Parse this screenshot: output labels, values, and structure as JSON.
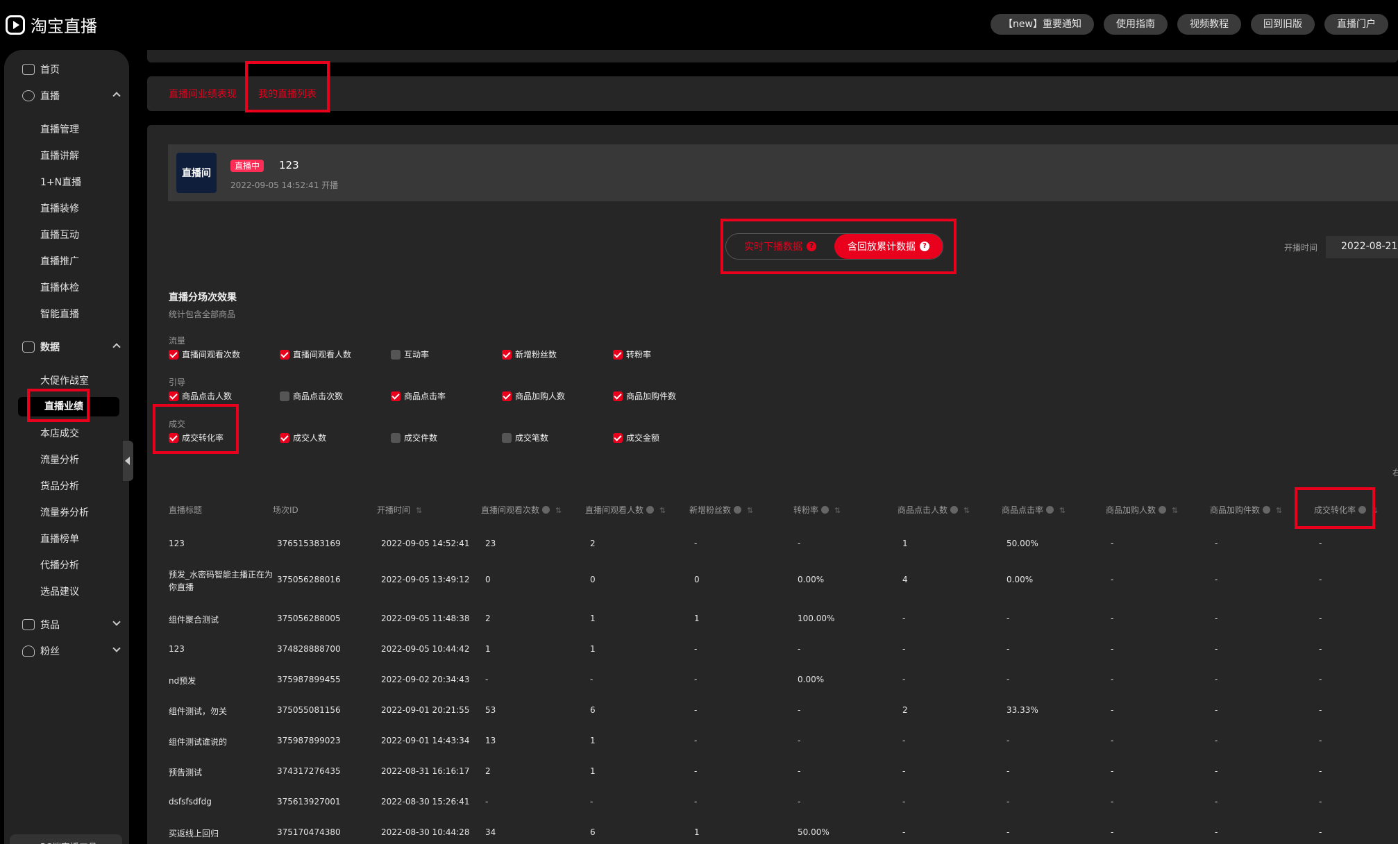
{
  "app": {
    "logo_text": "淘宝直播",
    "top_links": [
      "【new】重要通知",
      "使用指南",
      "视频教程",
      "回到旧版",
      "直播门户"
    ]
  },
  "sidebar": {
    "home": "首页",
    "live_group": "直播",
    "live_items": [
      "直播管理",
      "直播讲解",
      "1+N直播",
      "直播装修",
      "直播互动",
      "直播推广",
      "直播体检",
      "智能直播"
    ],
    "data_group": "数据",
    "data_items": [
      "大促作战室",
      "直播业绩",
      "本店成交",
      "流量分析",
      "货品分析",
      "流量券分析",
      "直播榜单",
      "代播分析",
      "选品建议"
    ],
    "active_item": "直播业绩",
    "goods_group": "货品",
    "fans_group": "粉丝",
    "bottom_tool": "PC端直播工具"
  },
  "tabs": [
    "直播间业绩表现",
    "我的直播列表"
  ],
  "live_card": {
    "thumb_text": "直播间",
    "badge": "直播中",
    "title": "123",
    "time": "2022-09-05 14:52:41 开播"
  },
  "toggle": {
    "realtime": "实时下播数据",
    "cumulative": "含回放累计数据",
    "selected": "含回放累计数据"
  },
  "date_filter": {
    "label": "开播时间",
    "value": "2022-08-21"
  },
  "section": {
    "title": "直播分场次效果",
    "subtitle": "统计包含全部商品"
  },
  "metric_groups": [
    {
      "label": "流量",
      "options": [
        {
          "label": "直播间观看次数",
          "checked": true
        },
        {
          "label": "直播间观看人数",
          "checked": true
        },
        {
          "label": "互动率",
          "checked": false
        },
        {
          "label": "新增粉丝数",
          "checked": true
        },
        {
          "label": "转粉率",
          "checked": true
        }
      ]
    },
    {
      "label": "引导",
      "options": [
        {
          "label": "商品点击人数",
          "checked": true
        },
        {
          "label": "商品点击次数",
          "checked": false
        },
        {
          "label": "商品点击率",
          "checked": true
        },
        {
          "label": "商品加购人数",
          "checked": true
        },
        {
          "label": "商品加购件数",
          "checked": true
        }
      ]
    },
    {
      "label": "成交",
      "options": [
        {
          "label": "成交转化率",
          "checked": true
        },
        {
          "label": "成交人数",
          "checked": true
        },
        {
          "label": "成交件数",
          "checked": false
        },
        {
          "label": "成交笔数",
          "checked": false
        },
        {
          "label": "成交金额",
          "checked": true
        }
      ]
    }
  ],
  "table": {
    "columns": [
      "直播标题",
      "场次ID",
      "开播时间",
      "直播间观看次数",
      "直播间观看人数",
      "新增粉丝数",
      "转粉率",
      "商品点击人数",
      "商品点击率",
      "商品加购人数",
      "商品加购件数",
      "成交转化率"
    ],
    "rows": [
      [
        "123",
        "376515383169",
        "2022-09-05 14:52:41",
        "23",
        "2",
        "-",
        "-",
        "1",
        "50.00%",
        "-",
        "-",
        "-"
      ],
      [
        "预发_水密码智能主播正在为你直播",
        "375056288016",
        "2022-09-05 13:49:12",
        "0",
        "0",
        "0",
        "0.00%",
        "4",
        "0.00%",
        "-",
        "-",
        "-"
      ],
      [
        "组件聚合测试",
        "375056288005",
        "2022-09-05 11:48:38",
        "2",
        "1",
        "1",
        "100.00%",
        "-",
        "-",
        "-",
        "-",
        "-"
      ],
      [
        "123",
        "374828888700",
        "2022-09-05 10:44:42",
        "1",
        "1",
        "-",
        "-",
        "-",
        "-",
        "-",
        "-",
        "-"
      ],
      [
        "nd预发",
        "375987899455",
        "2022-09-02 20:34:43",
        "-",
        "-",
        "-",
        "0.00%",
        "-",
        "-",
        "-",
        "-",
        "-"
      ],
      [
        "组件测试，勿关",
        "375055081156",
        "2022-09-01 20:21:55",
        "53",
        "6",
        "-",
        "-",
        "2",
        "33.33%",
        "-",
        "-",
        "-"
      ],
      [
        "组件测试谁说的",
        "375987899023",
        "2022-09-01 14:43:34",
        "13",
        "1",
        "-",
        "-",
        "-",
        "-",
        "-",
        "-",
        "-"
      ],
      [
        "预告测试",
        "374317276435",
        "2022-08-31 16:16:17",
        "2",
        "1",
        "-",
        "-",
        "-",
        "-",
        "-",
        "-",
        "-"
      ],
      [
        "dsfsfsdfdg",
        "375613927001",
        "2022-08-30 15:26:41",
        "-",
        "-",
        "-",
        "-",
        "-",
        "-",
        "-",
        "-",
        "-"
      ],
      [
        "买返线上回归",
        "375170474380",
        "2022-08-30 10:44:28",
        "34",
        "6",
        "1",
        "50.00%",
        "-",
        "-",
        "-",
        "-",
        "-"
      ]
    ]
  },
  "edge_text": "右",
  "colors": {
    "accent": "#e8001c",
    "bg": "#000000",
    "panel": "#262626",
    "sidebar": "#232323"
  }
}
